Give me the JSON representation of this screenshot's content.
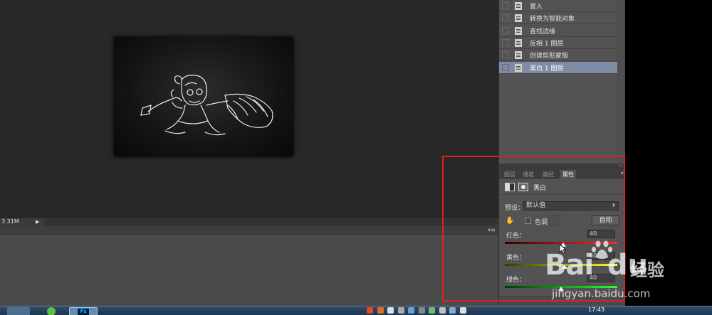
{
  "status": {
    "zoom_text": "3.31M"
  },
  "history": {
    "items": [
      {
        "label": "置入",
        "selected": false
      },
      {
        "label": "转换为智能对象",
        "selected": false
      },
      {
        "label": "查找边缘",
        "selected": false
      },
      {
        "label": "反相 1 图层",
        "selected": false
      },
      {
        "label": "创建剪贴蒙版",
        "selected": false
      },
      {
        "label": "黑白 1 图层",
        "selected": true
      }
    ]
  },
  "properties": {
    "tabs": [
      "图层",
      "通道",
      "路径",
      "属性"
    ],
    "active_tab": "属性",
    "adjustment_title": "黑白",
    "preset_label": "预设：",
    "preset_value": "默认值",
    "tint_label": "色调",
    "tint_checked": false,
    "auto_button": "自动",
    "sliders": [
      {
        "label": "红色：",
        "value": "40",
        "level": 0.52,
        "gradient": "linear-gradient(to right, #3a0000, #ff2a2a)"
      },
      {
        "label": "黄色：",
        "value": "60",
        "level": 0.53,
        "gradient": "linear-gradient(to right, #3a3a00, #ffff2a)"
      },
      {
        "label": "绿色：",
        "value": "40",
        "level": 0.5,
        "gradient": "linear-gradient(to right, #003a00, #2aff2a)"
      }
    ]
  },
  "watermark": {
    "brand": "Bai",
    "brand2": "du",
    "product": "经验",
    "url": "jingyan.baidu.com"
  },
  "taskbar": {
    "ps_label": "Ps",
    "clock": "17:43"
  },
  "colors": {
    "selection": "#7f8ca6",
    "highlight_frame": "#e02020"
  }
}
